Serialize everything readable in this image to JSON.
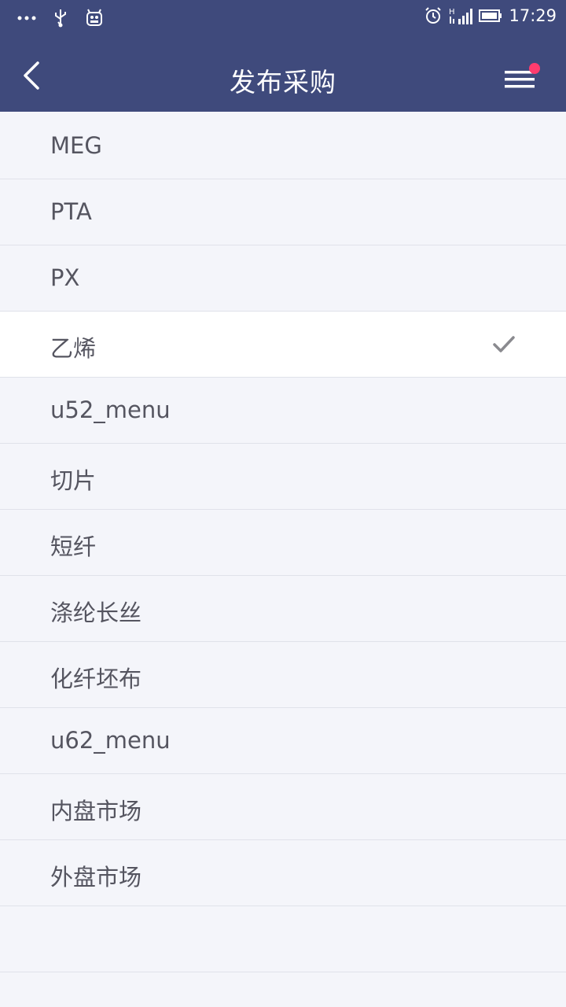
{
  "status_bar": {
    "time": "17:29",
    "left_icons": [
      "more-dots-icon",
      "usb-icon",
      "android-debug-icon"
    ],
    "right_icons": [
      "alarm-icon",
      "signal-icon",
      "battery-icon"
    ]
  },
  "header": {
    "title": "发布采购",
    "back_icon": "chevron-left-icon",
    "menu_icon": "hamburger-menu-icon",
    "notification_color": "#ff3c6e"
  },
  "colors": {
    "accent": "#3f4a7c",
    "background": "#f4f5fa",
    "selected_row": "#ffffff"
  },
  "list": {
    "items": [
      {
        "label": "MEG",
        "selected": false
      },
      {
        "label": "PTA",
        "selected": false
      },
      {
        "label": "PX",
        "selected": false
      },
      {
        "label": "乙烯",
        "selected": true
      },
      {
        "label": "u52_menu",
        "selected": false
      },
      {
        "label": "切片",
        "selected": false
      },
      {
        "label": "短纤",
        "selected": false
      },
      {
        "label": "涤纶长丝",
        "selected": false
      },
      {
        "label": "化纤坯布",
        "selected": false
      },
      {
        "label": "u62_menu",
        "selected": false
      },
      {
        "label": "内盘市场",
        "selected": false
      },
      {
        "label": "外盘市场",
        "selected": false
      }
    ]
  }
}
